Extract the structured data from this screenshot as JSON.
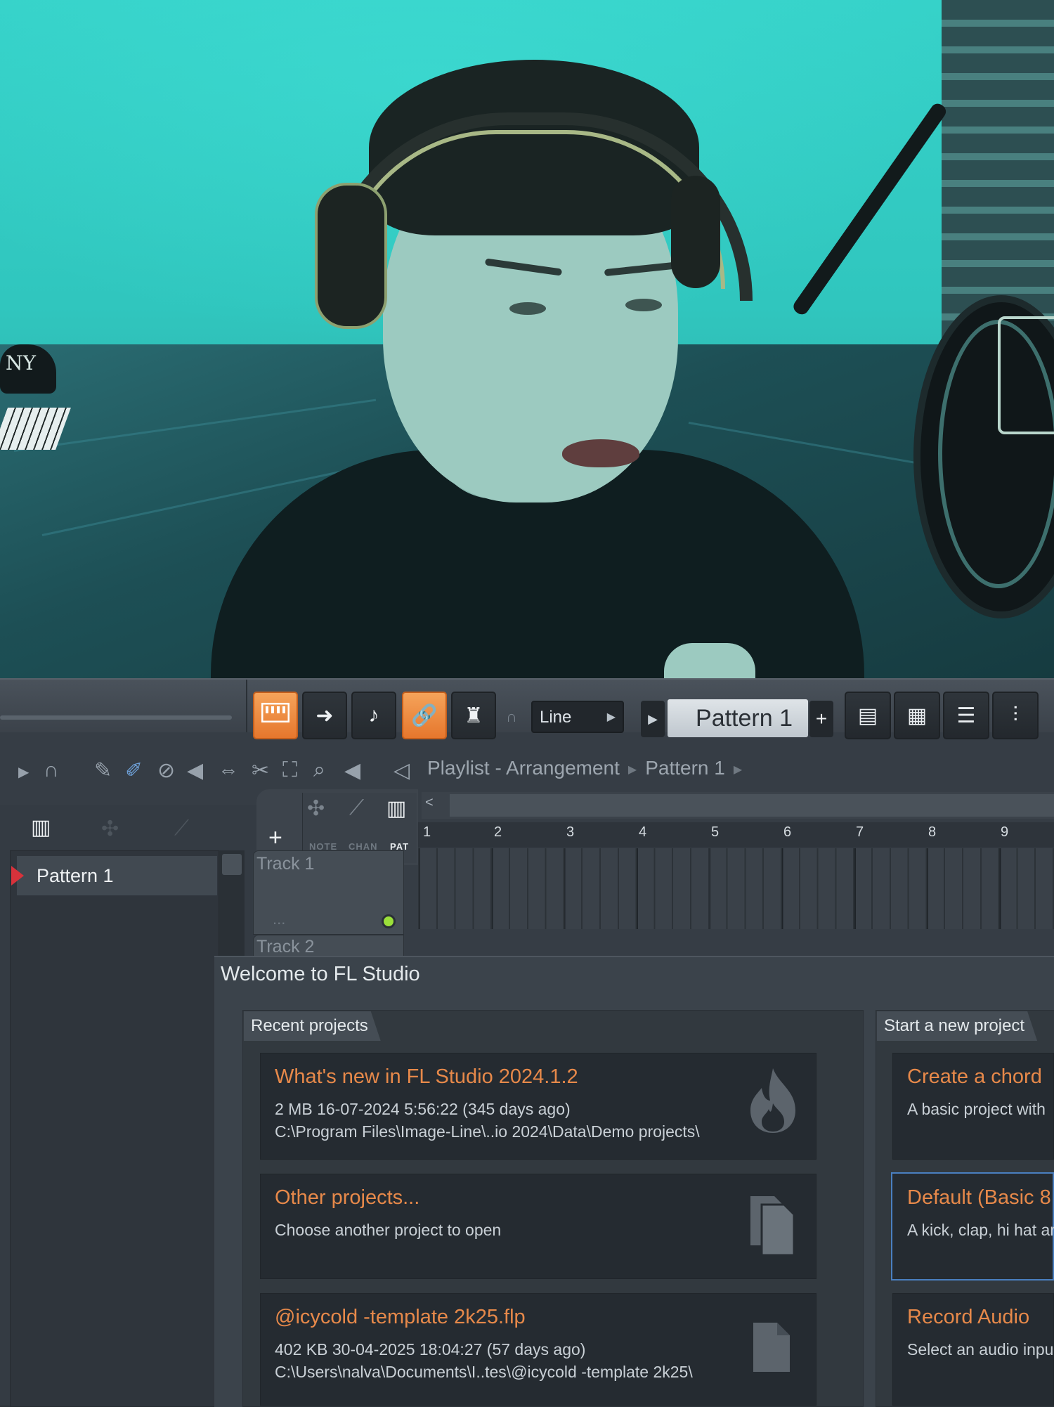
{
  "toolbar": {
    "snap_mode": "Line",
    "pattern_name": "Pattern 1",
    "pattern_add": "+",
    "active_buttons": [
      "typing-keyboard-to-piano",
      "multilink-controllers"
    ],
    "accent_color": "#f0913f"
  },
  "playlist": {
    "breadcrumb_root": "Playlist - Arrangement",
    "breadcrumb_pattern": "Pattern 1",
    "tools": [
      "play-arrow-icon",
      "magnet-snap-icon",
      "draw-icon",
      "paint-icon",
      "delete-icon",
      "mute-icon",
      "slip-icon",
      "slice-icon",
      "select-icon",
      "zoom-icon",
      "playback-icon"
    ],
    "picker_tabs": [
      {
        "label": "NOTE",
        "active": false
      },
      {
        "label": "CHAN",
        "active": false
      },
      {
        "label": "PAT",
        "active": true
      }
    ],
    "add_track_label": "+",
    "ruler": [
      "1",
      "2",
      "3",
      "4",
      "5",
      "6",
      "7",
      "8",
      "9"
    ],
    "tracks": [
      {
        "name": "Track 1",
        "dots": "..."
      },
      {
        "name": "Track 2"
      }
    ]
  },
  "pattern_list": {
    "items": [
      "Pattern 1"
    ],
    "marker_color": "#d8323b"
  },
  "welcome": {
    "title": "Welcome to FL Studio",
    "recent_tab": "Recent projects",
    "new_tab": "Start a new project",
    "recent": [
      {
        "title": "What's new in FL Studio 2024.1.2",
        "meta": "2 MB  16-07-2024 5:56:22  (345 days ago)",
        "path": "C:\\Program Files\\Image-Line\\..io 2024\\Data\\Demo projects\\",
        "icon": "fl-studio-flame-icon"
      },
      {
        "title": "Other projects...",
        "meta": "Choose another project to open",
        "path": "",
        "icon": "documents-icon"
      },
      {
        "title": "@icycold -template 2k25.flp",
        "meta": "402 KB  30-04-2025 18:04:27  (57 days ago)",
        "path": "C:\\Users\\nalva\\Documents\\I..tes\\@icycold -template 2k25\\",
        "icon": "document-icon"
      }
    ],
    "templates": [
      {
        "title": "Create a chord",
        "desc": "A basic project with",
        "selected": false
      },
      {
        "title": "Default (Basic 8",
        "desc": "A kick, clap, hi hat ar",
        "selected": true
      },
      {
        "title": "Record Audio",
        "desc": "Select an audio inpu",
        "selected": false
      }
    ],
    "title_color": "#e7894a",
    "selected_border_color": "#4a7fc0"
  },
  "photo": {
    "cap_logo": "NY"
  }
}
